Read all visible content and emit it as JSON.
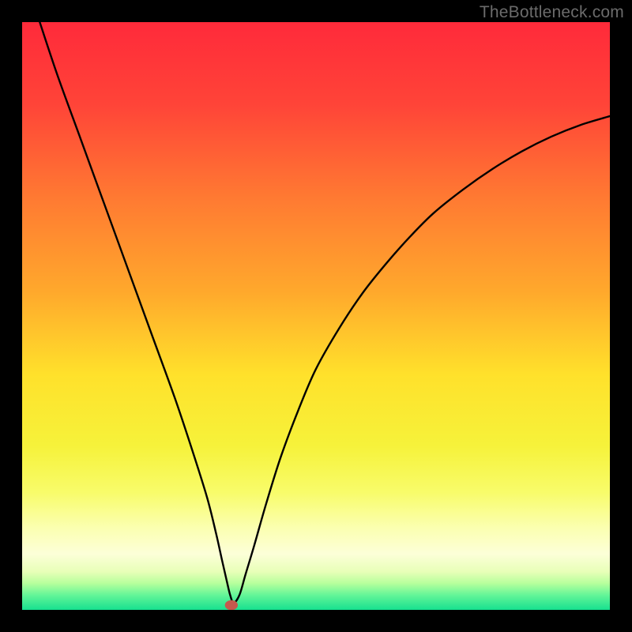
{
  "watermark": "TheBottleneck.com",
  "chart_data": {
    "type": "line",
    "title": "",
    "xlabel": "",
    "ylabel": "",
    "xlim": [
      0,
      100
    ],
    "ylim": [
      0,
      100
    ],
    "grid": false,
    "legend": false,
    "background_gradient": {
      "stops": [
        {
          "offset": 0.0,
          "color": "#ff2a3a"
        },
        {
          "offset": 0.14,
          "color": "#ff4438"
        },
        {
          "offset": 0.3,
          "color": "#ff7a32"
        },
        {
          "offset": 0.46,
          "color": "#ffa92c"
        },
        {
          "offset": 0.6,
          "color": "#ffe12b"
        },
        {
          "offset": 0.72,
          "color": "#f6f23a"
        },
        {
          "offset": 0.8,
          "color": "#f8fc6a"
        },
        {
          "offset": 0.86,
          "color": "#fbffb0"
        },
        {
          "offset": 0.905,
          "color": "#fcffd8"
        },
        {
          "offset": 0.935,
          "color": "#e8ffb8"
        },
        {
          "offset": 0.955,
          "color": "#b6ff9c"
        },
        {
          "offset": 0.975,
          "color": "#63f598"
        },
        {
          "offset": 1.0,
          "color": "#17e08f"
        }
      ]
    },
    "series": [
      {
        "name": "bottleneck-curve",
        "color": "#000000",
        "width": 2.4,
        "x": [
          3,
          6,
          10,
          14,
          18,
          22,
          26,
          29,
          31.5,
          33,
          34,
          34.8,
          35.4,
          36,
          37,
          38,
          39.5,
          41.5,
          44,
          47,
          50,
          54,
          58,
          62,
          66,
          70,
          75,
          80,
          85,
          90,
          95,
          100
        ],
        "y": [
          100,
          91,
          80,
          69,
          58,
          47,
          36,
          27,
          19,
          13,
          8.5,
          5,
          2.5,
          1.2,
          2.6,
          6,
          11,
          18,
          26,
          34,
          41,
          48,
          54,
          59,
          63.5,
          67.5,
          71.5,
          75,
          78,
          80.5,
          82.5,
          84
        ]
      }
    ],
    "marker": {
      "name": "optimal-point",
      "x": 35.6,
      "y": 0.8,
      "rx": 1.1,
      "ry": 0.85,
      "fill": "#c5584d"
    }
  }
}
